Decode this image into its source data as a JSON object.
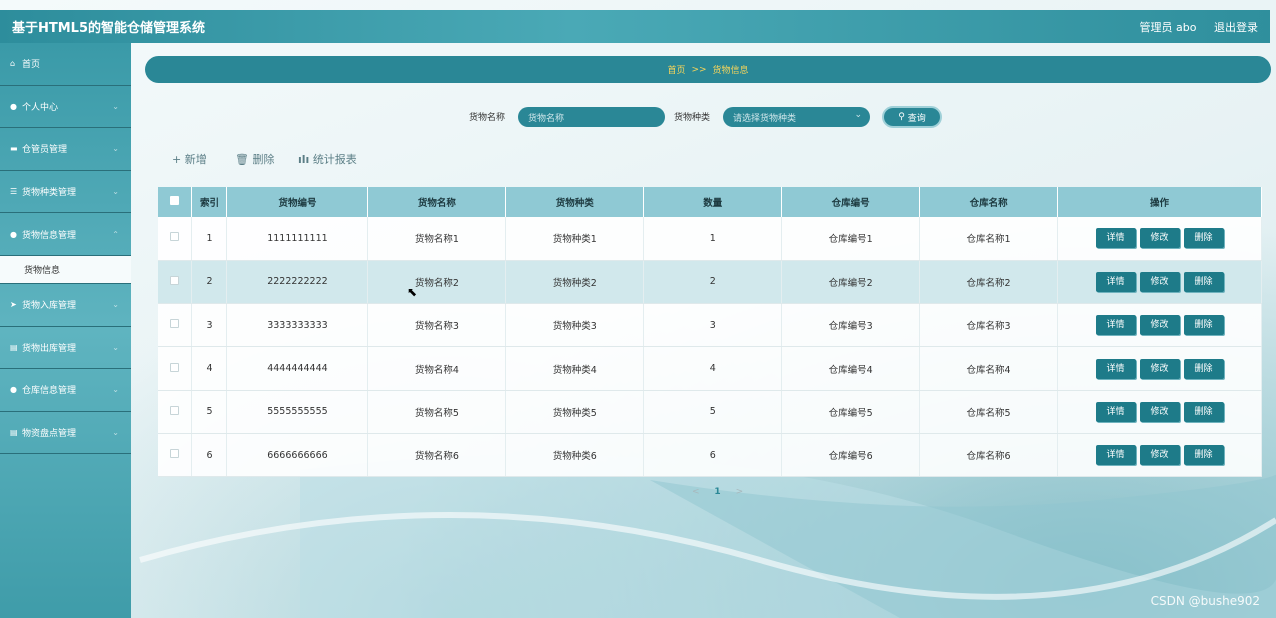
{
  "app": {
    "title": "基于HTML5的智能仓储管理系统",
    "user_label": "管理员 abo",
    "logout_label": "退出登录"
  },
  "sidebar": {
    "items": [
      {
        "label": "首页",
        "icon": "home-icon"
      },
      {
        "label": "个人中心",
        "icon": "user-icon"
      },
      {
        "label": "仓管员管理",
        "icon": "warehouse-icon"
      },
      {
        "label": "货物种类管理",
        "icon": "list-icon"
      },
      {
        "label": "货物信息管理",
        "icon": "user-icon"
      },
      {
        "label": "货物入库管理",
        "icon": "send-icon"
      },
      {
        "label": "货物出库管理",
        "icon": "clipboard-icon"
      },
      {
        "label": "仓库信息管理",
        "icon": "user-icon"
      },
      {
        "label": "物资盘点管理",
        "icon": "clipboard-icon"
      }
    ],
    "sub_active": "货物信息"
  },
  "breadcrumb": {
    "home": "首页",
    "sep": ">>",
    "current": "货物信息"
  },
  "search": {
    "name_label": "货物名称",
    "name_placeholder": "货物名称",
    "type_label": "货物种类",
    "type_placeholder": "请选择货物种类",
    "query_label": "查询"
  },
  "actions": {
    "add": "+ 新增",
    "delete": "删除",
    "report": "统计报表"
  },
  "table": {
    "headers": [
      "索引",
      "货物编号",
      "货物名称",
      "货物种类",
      "数量",
      "仓库编号",
      "仓库名称",
      "操作"
    ],
    "rows": [
      {
        "idx": "1",
        "code": "1111111111",
        "name": "货物名称1",
        "type": "货物种类1",
        "qty": "1",
        "wh_code": "仓库编号1",
        "wh_name": "仓库名称1"
      },
      {
        "idx": "2",
        "code": "2222222222",
        "name": "货物名称2",
        "type": "货物种类2",
        "qty": "2",
        "wh_code": "仓库编号2",
        "wh_name": "仓库名称2"
      },
      {
        "idx": "3",
        "code": "3333333333",
        "name": "货物名称3",
        "type": "货物种类3",
        "qty": "3",
        "wh_code": "仓库编号3",
        "wh_name": "仓库名称3"
      },
      {
        "idx": "4",
        "code": "4444444444",
        "name": "货物名称4",
        "type": "货物种类4",
        "qty": "4",
        "wh_code": "仓库编号4",
        "wh_name": "仓库名称4"
      },
      {
        "idx": "5",
        "code": "5555555555",
        "name": "货物名称5",
        "type": "货物种类5",
        "qty": "5",
        "wh_code": "仓库编号5",
        "wh_name": "仓库名称5"
      },
      {
        "idx": "6",
        "code": "6666666666",
        "name": "货物名称6",
        "type": "货物种类6",
        "qty": "6",
        "wh_code": "仓库编号6",
        "wh_name": "仓库名称6"
      }
    ],
    "ops": {
      "detail": "详情",
      "edit": "修改",
      "delete": "删除"
    }
  },
  "pager": {
    "prev": "<",
    "page": "1",
    "next": ">"
  },
  "watermark": "CSDN @bushe902",
  "colors": {
    "primary": "#2a8796",
    "header_bg": "#8fc9d4",
    "breadcrumb_text": "#f6d55a",
    "op_button": "#1e7b89"
  }
}
